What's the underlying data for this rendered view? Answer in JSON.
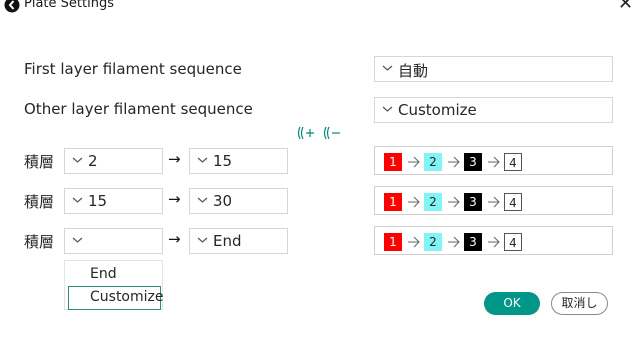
{
  "window": {
    "title": "Plate Settings",
    "app_icon": "bambu-app-icon",
    "close_glyph": "✕"
  },
  "first_layer": {
    "label": "First layer filament sequence",
    "value": "自動"
  },
  "other_layer": {
    "label": "Other layer filament sequence",
    "value": "Customize"
  },
  "toolbar": {
    "add_icon": "add-layer-range-icon",
    "remove_icon": "remove-layer-range-icon"
  },
  "ranges": [
    {
      "label": "積層",
      "from": "2",
      "to": "15"
    },
    {
      "label": "積層",
      "from": "15",
      "to": "30"
    },
    {
      "label": "積層",
      "from": "",
      "to": "End"
    }
  ],
  "range_arrow": "→",
  "sequence": {
    "chips": [
      "1",
      "2",
      "3",
      "4"
    ],
    "colors": [
      "#ff0000",
      "#7ff5f5",
      "#000000",
      "#ffffff"
    ],
    "text_colors": [
      "#ffffff",
      "#262626",
      "#ffffff",
      "#262626"
    ]
  },
  "dropdown": {
    "options": [
      "End",
      "Customize"
    ],
    "highlighted": "Customize"
  },
  "buttons": {
    "ok": "OK",
    "cancel": "取消し"
  },
  "accent_color": "#009688"
}
